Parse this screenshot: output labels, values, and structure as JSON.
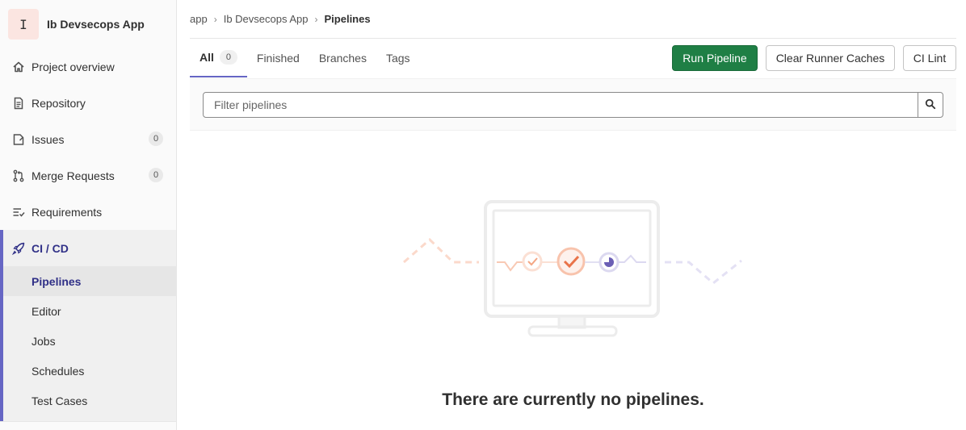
{
  "sidebar": {
    "avatar_letter": "I",
    "project_name": "Ib Devsecops App",
    "items": [
      {
        "label": "Project overview",
        "icon": "home-icon"
      },
      {
        "label": "Repository",
        "icon": "document-icon"
      },
      {
        "label": "Issues",
        "icon": "issues-icon",
        "count": "0"
      },
      {
        "label": "Merge Requests",
        "icon": "merge-request-icon",
        "count": "0"
      },
      {
        "label": "Requirements",
        "icon": "requirements-icon"
      },
      {
        "label": "CI / CD",
        "icon": "rocket-icon"
      }
    ],
    "cicd_sub": [
      {
        "label": "Pipelines"
      },
      {
        "label": "Editor"
      },
      {
        "label": "Jobs"
      },
      {
        "label": "Schedules"
      },
      {
        "label": "Test Cases"
      }
    ]
  },
  "breadcrumb": {
    "items": [
      "app",
      "Ib Devsecops App",
      "Pipelines"
    ]
  },
  "tabs": [
    {
      "label": "All",
      "count": "0"
    },
    {
      "label": "Finished"
    },
    {
      "label": "Branches"
    },
    {
      "label": "Tags"
    }
  ],
  "actions": {
    "run_pipeline": "Run Pipeline",
    "clear_caches": "Clear Runner Caches",
    "ci_lint": "CI Lint"
  },
  "filter": {
    "placeholder": "Filter pipelines"
  },
  "empty_state": {
    "title": "There are currently no pipelines."
  },
  "colors": {
    "accent": "#6666c4",
    "primary_button": "#1f7f45",
    "success_orange": "#e9744a"
  }
}
